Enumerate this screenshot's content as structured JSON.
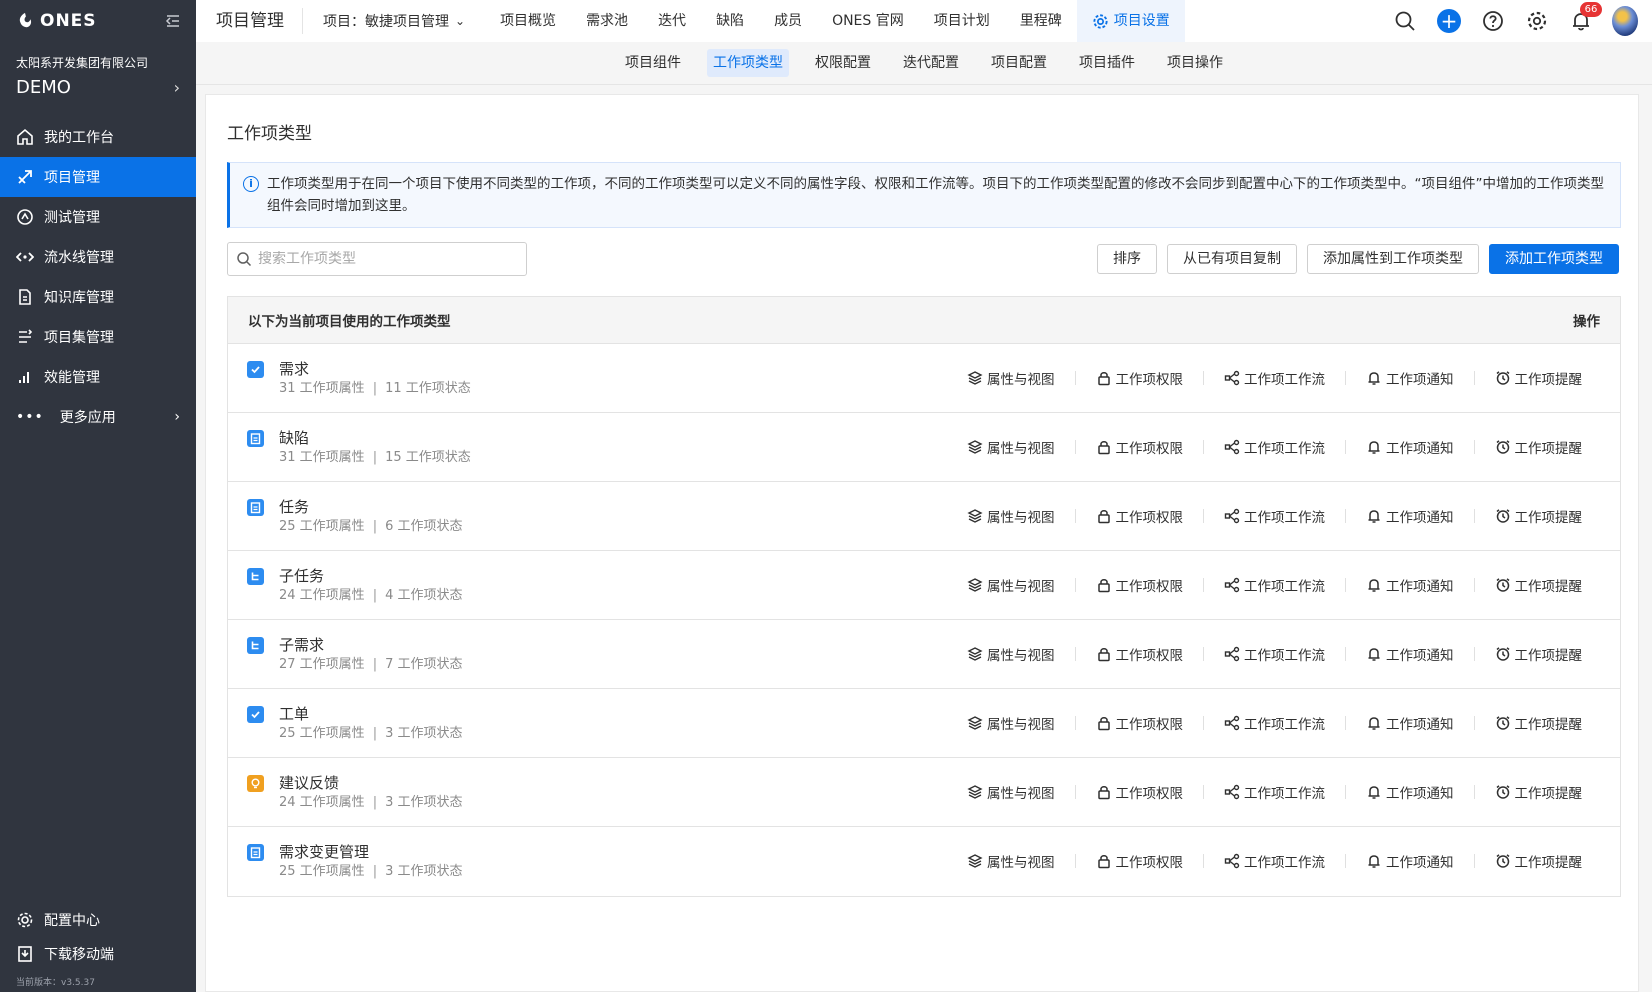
{
  "brand": {
    "logo_text": "ONES"
  },
  "sidebar": {
    "company": "太阳系开发集团有限公司",
    "org": "DEMO",
    "items": [
      {
        "label": "我的工作台",
        "icon": "home-icon"
      },
      {
        "label": "项目管理",
        "icon": "project-icon",
        "active": true
      },
      {
        "label": "测试管理",
        "icon": "test-icon"
      },
      {
        "label": "流水线管理",
        "icon": "pipeline-icon"
      },
      {
        "label": "知识库管理",
        "icon": "wiki-icon"
      },
      {
        "label": "项目集管理",
        "icon": "program-icon"
      },
      {
        "label": "效能管理",
        "icon": "performance-icon"
      }
    ],
    "more_label": "更多应用",
    "bottom": [
      {
        "label": "配置中心",
        "icon": "gear-icon"
      },
      {
        "label": "下载移动端",
        "icon": "download-icon"
      }
    ],
    "version": "当前版本：v3.5.37"
  },
  "topbar": {
    "title": "项目管理",
    "project_select": "项目：敏捷项目管理",
    "tabs": [
      "项目概览",
      "需求池",
      "迭代",
      "缺陷",
      "成员",
      "ONES 官网",
      "项目计划",
      "里程碑",
      "项目设置"
    ],
    "active_tab": "项目设置",
    "notification_count": "66"
  },
  "subtabs": {
    "items": [
      "项目组件",
      "工作项类型",
      "权限配置",
      "迭代配置",
      "项目配置",
      "项目插件",
      "项目操作"
    ],
    "active": "工作项类型"
  },
  "main": {
    "title": "工作项类型",
    "notice": "工作项类型用于在同一个项目下使用不同类型的工作项，不同的工作项类型可以定义不同的属性字段、权限和工作流等。项目下的工作项类型配置的修改不会同步到配置中心下的工作项类型中。“项目组件”中增加的工作项类型组件会同时增加到这里。",
    "search_placeholder": "搜索工作项类型",
    "buttons": {
      "sort": "排序",
      "copy": "从已有项目复制",
      "add_attr": "添加属性到工作项类型",
      "add_type": "添加工作项类型"
    },
    "table": {
      "header": "以下为当前项目使用的工作项类型",
      "header_action": "操作",
      "row_actions": [
        "属性与视图",
        "工作项权限",
        "工作项工作流",
        "工作项通知",
        "工作项提醒"
      ],
      "rows": [
        {
          "name": "需求",
          "attrs": "31 工作项属性",
          "states": "11 工作项状态",
          "icon": "requirement-icon",
          "color": "#2d8cf0"
        },
        {
          "name": "缺陷",
          "attrs": "31 工作项属性",
          "states": "15 工作项状态",
          "icon": "clipboard-icon",
          "color": "#2d8cf0"
        },
        {
          "name": "任务",
          "attrs": "25 工作项属性",
          "states": "6 工作项状态",
          "icon": "clipboard-icon",
          "color": "#2d8cf0"
        },
        {
          "name": "子任务",
          "attrs": "24 工作项属性",
          "states": "4 工作项状态",
          "icon": "subtask-icon",
          "color": "#2d8cf0"
        },
        {
          "name": "子需求",
          "attrs": "27 工作项属性",
          "states": "7 工作项状态",
          "icon": "subtask-icon",
          "color": "#2d8cf0"
        },
        {
          "name": "工单",
          "attrs": "25 工作项属性",
          "states": "3 工作项状态",
          "icon": "requirement-icon",
          "color": "#2d8cf0"
        },
        {
          "name": "建议反馈",
          "attrs": "24 工作项属性",
          "states": "3 工作项状态",
          "icon": "bulb-icon",
          "color": "#f0a020"
        },
        {
          "name": "需求变更管理",
          "attrs": "25 工作项属性",
          "states": "3 工作项状态",
          "icon": "clipboard-icon",
          "color": "#2d8cf0"
        }
      ]
    }
  }
}
